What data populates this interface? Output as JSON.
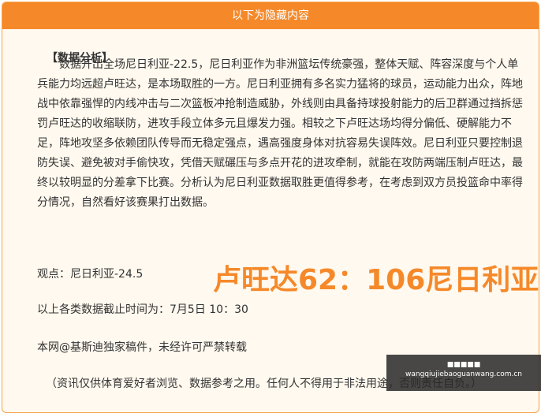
{
  "header": {
    "title": "以下为隐藏内容"
  },
  "main": {
    "heading": "【数据分析】",
    "analysis": "　　数据开出全场尼日利亚-22.5，尼日利亚作为非洲篮坛传统豪强，整体天赋、阵容深度与个人单兵能力均远超卢旺达，是本场取胜的一方。尼日利亚拥有多名实力猛将的球员，运动能力出众，阵地战中依靠强悍的内线冲击与二次篮板冲抢制造威胁，外线则由具备持球投射能力的后卫群通过挡拆惩罚卢旺达的收缩联防，进攻手段立体多元且爆发力强。相较之下卢旺达场均得分偏低、硬解能力不足，阵地攻坚多依赖团队传导而无稳定强点，遇高强度身体对抗容易失误阵效。尼日利亚只要控制退防失误、避免被对手偷快攻，凭借天赋碾压与多点开花的进攻牵制，就能在攻防两端压制卢旺达，最终以较明显的分差拿下比赛。分析认为尼日利亚数据取胜更值得参考，在考虑到双方员投篮命中率得分情况，自然看好该赛果打出数据。",
    "view": "观点：尼日利亚-24.5",
    "score": "卢旺达62：106尼日利亚",
    "cutoff": "以上各类数据截止时间为：7月5日 10：30",
    "copyright": "本网@基斯迪独家稿件，未经许可严禁转载",
    "disclaimer": "（资讯仅供体育爱好者浏览、数据参考之用。任何人不得用于非法用途，否则责任自负。）"
  },
  "watermark": {
    "line1": "■■■■■",
    "line2": "wangqiujiebaoguanwang.com.cn"
  },
  "colors": {
    "accent": "#f5892a",
    "panel_bg": "#fff9ef"
  }
}
